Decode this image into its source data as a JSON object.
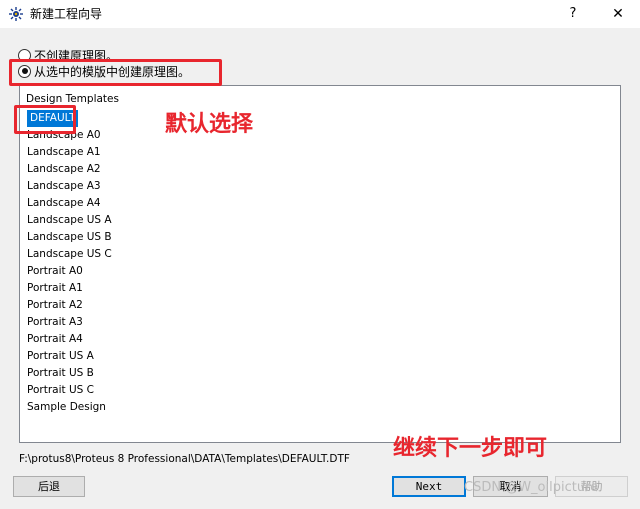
{
  "window": {
    "title": "新建工程向导",
    "help_glyph": "?",
    "close_glyph": "✕"
  },
  "options": {
    "no_schematic": "不创建原理图。",
    "from_template": "从选中的模版中创建原理图。",
    "selected": "from_template"
  },
  "templates": {
    "header": "Design Templates",
    "items": [
      "DEFAULT",
      "Landscape A0",
      "Landscape A1",
      "Landscape A2",
      "Landscape A3",
      "Landscape A4",
      "Landscape US A",
      "Landscape US B",
      "Landscape US C",
      "Portrait A0",
      "Portrait A1",
      "Portrait A2",
      "Portrait A3",
      "Portrait A4",
      "Portrait US A",
      "Portrait US B",
      "Portrait US C",
      "Sample Design"
    ],
    "selected_index": 0
  },
  "path": "F:\\protus8\\Proteus 8 Professional\\DATA\\Templates\\DEFAULT.DTF",
  "buttons": {
    "back": "后退",
    "next": "Next",
    "cancel": "取消",
    "help": "帮助"
  },
  "annotations": {
    "default_selection": "默认选择",
    "continue_next": "继续下一步即可",
    "color": "#e8262e"
  },
  "watermark": "CSDN @W_oilpicture"
}
